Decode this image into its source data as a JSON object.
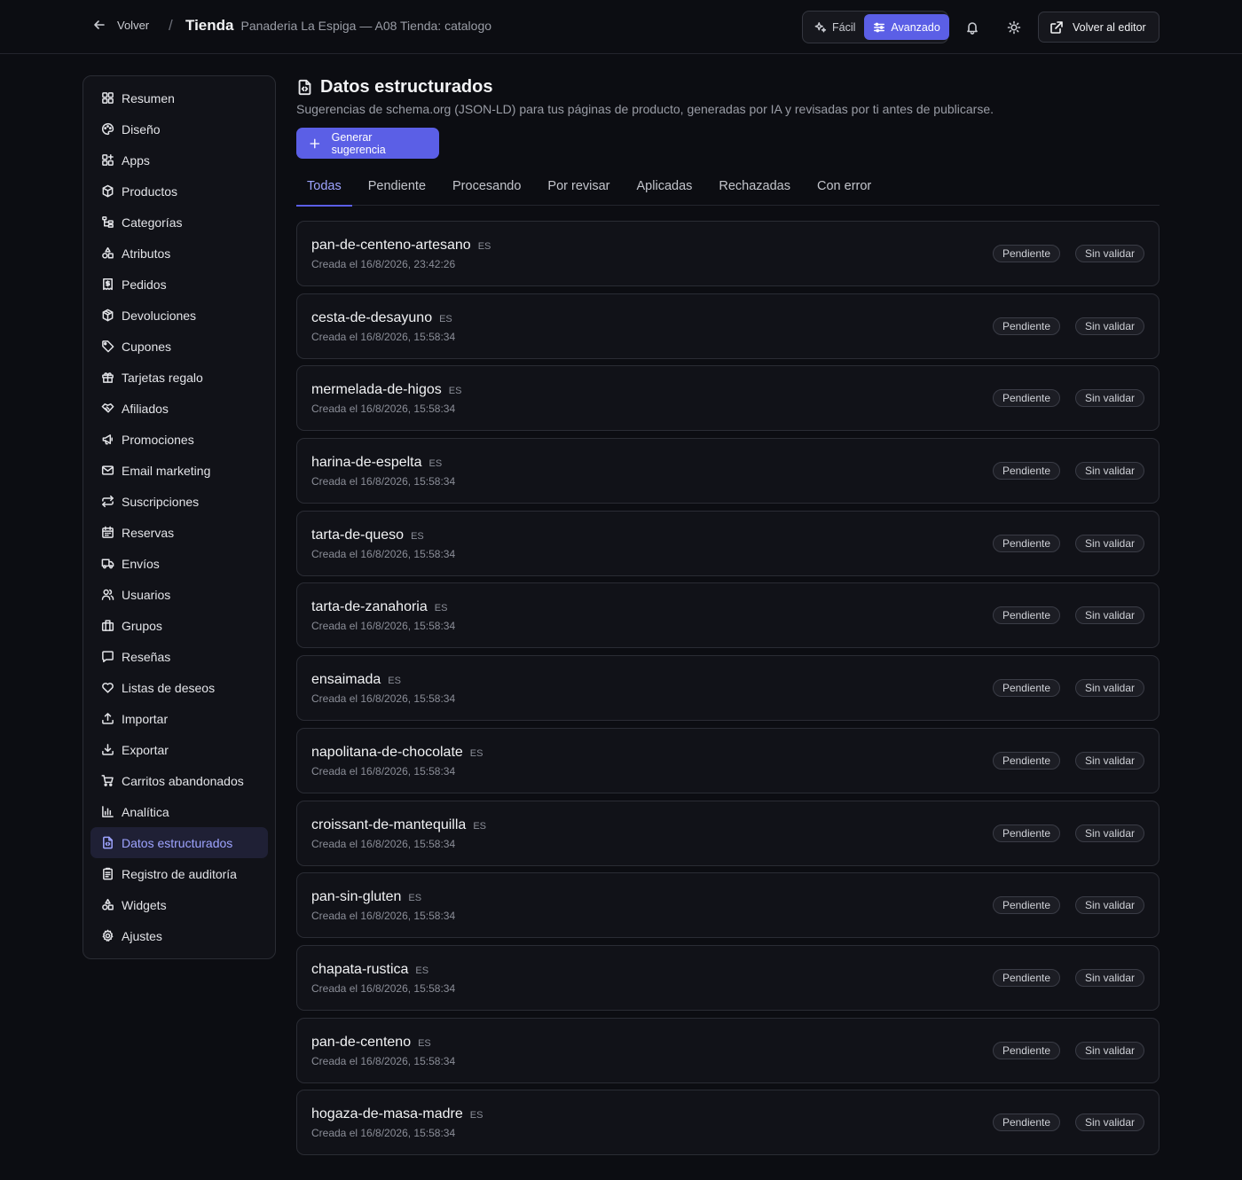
{
  "header": {
    "back_label": "Volver",
    "separator": "/",
    "title": "Tienda",
    "subtitle": "Panaderia La Espiga — A08 Tienda: catalogo",
    "mode_easy": "Fácil",
    "mode_advanced": "Avanzado",
    "editor_label": "Volver al editor"
  },
  "sidebar": {
    "items": [
      {
        "label": "Resumen",
        "icon": "grid-icon"
      },
      {
        "label": "Diseño",
        "icon": "palette-icon"
      },
      {
        "label": "Apps",
        "icon": "apps-icon"
      },
      {
        "label": "Productos",
        "icon": "box-icon"
      },
      {
        "label": "Categorías",
        "icon": "tree-icon"
      },
      {
        "label": "Atributos",
        "icon": "shapes-icon"
      },
      {
        "label": "Pedidos",
        "icon": "receipt-icon"
      },
      {
        "label": "Devoluciones",
        "icon": "box-return-icon"
      },
      {
        "label": "Cupones",
        "icon": "tag-icon"
      },
      {
        "label": "Tarjetas regalo",
        "icon": "gift-icon"
      },
      {
        "label": "Afiliados",
        "icon": "handshake-icon"
      },
      {
        "label": "Promociones",
        "icon": "megaphone-icon"
      },
      {
        "label": "Email marketing",
        "icon": "mail-icon"
      },
      {
        "label": "Suscripciones",
        "icon": "repeat-icon"
      },
      {
        "label": "Reservas",
        "icon": "calendar-icon"
      },
      {
        "label": "Envíos",
        "icon": "truck-icon"
      },
      {
        "label": "Usuarios",
        "icon": "users-icon"
      },
      {
        "label": "Grupos",
        "icon": "building-icon"
      },
      {
        "label": "Reseñas",
        "icon": "message-icon"
      },
      {
        "label": "Listas de deseos",
        "icon": "heart-icon"
      },
      {
        "label": "Importar",
        "icon": "upload-icon"
      },
      {
        "label": "Exportar",
        "icon": "download-icon"
      },
      {
        "label": "Carritos abandonados",
        "icon": "cart-icon"
      },
      {
        "label": "Analítica",
        "icon": "chart-icon"
      },
      {
        "label": "Datos estructurados",
        "icon": "file-code-icon",
        "active": true
      },
      {
        "label": "Registro de auditoría",
        "icon": "clipboard-icon"
      },
      {
        "label": "Widgets",
        "icon": "shapes-icon"
      },
      {
        "label": "Ajustes",
        "icon": "gear-icon"
      }
    ]
  },
  "page": {
    "title": "Datos estructurados",
    "subtitle": "Sugerencias de schema.org (JSON-LD) para tus páginas de producto, generadas por IA y revisadas por ti antes de publicarse.",
    "generate_label": "Generar sugerencia"
  },
  "tabs": [
    "Todas",
    "Pendiente",
    "Procesando",
    "Por revisar",
    "Aplicadas",
    "Rechazadas",
    "Con error"
  ],
  "active_tab": 0,
  "suggestions": [
    {
      "slug": "pan-de-centeno-artesano",
      "lang": "ES",
      "created": "Creada el 16/8/2026, 23:42:26",
      "status": "Pendiente",
      "validation": "Sin validar"
    },
    {
      "slug": "cesta-de-desayuno",
      "lang": "ES",
      "created": "Creada el 16/8/2026, 15:58:34",
      "status": "Pendiente",
      "validation": "Sin validar"
    },
    {
      "slug": "mermelada-de-higos",
      "lang": "ES",
      "created": "Creada el 16/8/2026, 15:58:34",
      "status": "Pendiente",
      "validation": "Sin validar"
    },
    {
      "slug": "harina-de-espelta",
      "lang": "ES",
      "created": "Creada el 16/8/2026, 15:58:34",
      "status": "Pendiente",
      "validation": "Sin validar"
    },
    {
      "slug": "tarta-de-queso",
      "lang": "ES",
      "created": "Creada el 16/8/2026, 15:58:34",
      "status": "Pendiente",
      "validation": "Sin validar"
    },
    {
      "slug": "tarta-de-zanahoria",
      "lang": "ES",
      "created": "Creada el 16/8/2026, 15:58:34",
      "status": "Pendiente",
      "validation": "Sin validar"
    },
    {
      "slug": "ensaimada",
      "lang": "ES",
      "created": "Creada el 16/8/2026, 15:58:34",
      "status": "Pendiente",
      "validation": "Sin validar"
    },
    {
      "slug": "napolitana-de-chocolate",
      "lang": "ES",
      "created": "Creada el 16/8/2026, 15:58:34",
      "status": "Pendiente",
      "validation": "Sin validar"
    },
    {
      "slug": "croissant-de-mantequilla",
      "lang": "ES",
      "created": "Creada el 16/8/2026, 15:58:34",
      "status": "Pendiente",
      "validation": "Sin validar"
    },
    {
      "slug": "pan-sin-gluten",
      "lang": "ES",
      "created": "Creada el 16/8/2026, 15:58:34",
      "status": "Pendiente",
      "validation": "Sin validar"
    },
    {
      "slug": "chapata-rustica",
      "lang": "ES",
      "created": "Creada el 16/8/2026, 15:58:34",
      "status": "Pendiente",
      "validation": "Sin validar"
    },
    {
      "slug": "pan-de-centeno",
      "lang": "ES",
      "created": "Creada el 16/8/2026, 15:58:34",
      "status": "Pendiente",
      "validation": "Sin validar"
    },
    {
      "slug": "hogaza-de-masa-madre",
      "lang": "ES",
      "created": "Creada el 16/8/2026, 15:58:34",
      "status": "Pendiente",
      "validation": "Sin validar"
    }
  ],
  "colors": {
    "accent": "#5b5fe6",
    "accent_text": "#9ea4ff",
    "background": "#0c0d12",
    "surface": "#111218"
  }
}
